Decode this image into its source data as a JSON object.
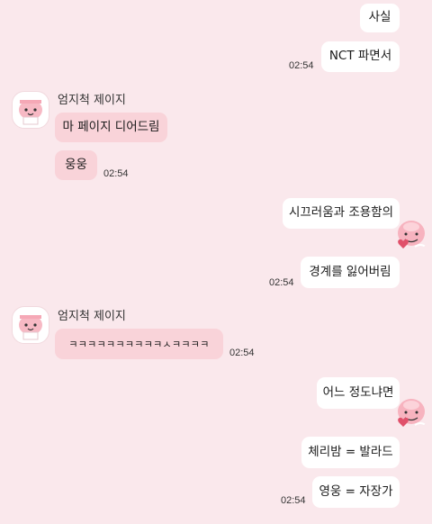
{
  "messages": {
    "m1": "사실",
    "m2": "NCT 파면서",
    "t1": "02:54",
    "sender1": "엄지척 제이지",
    "m3": "마 페이지 디어드림",
    "m4": "웅웅",
    "t2": "02:54",
    "m5": "시끄러움과 조용함의",
    "m6": "경계를 잃어버림",
    "t3": "02:54",
    "sender2": "엄지척 제이지",
    "m7": "ㅋㅋㅋㅋㅋㅋㅋㅋㅋㅋㅅㅋㅋㅋㅋ",
    "t4": "02:54",
    "m8": "어느 정도냐면",
    "m9": "체리밤 = 발라드",
    "m10": "영웅 = 자장가",
    "t5": "02:54"
  },
  "icons": {
    "friend_avatar": "peach-character-avatar",
    "my_avatar": "peach-character-heart-avatar"
  },
  "colors": {
    "background": "#fae8ec",
    "outgoing_bubble": "#ffffff",
    "incoming_bubble": "#f9d3d9"
  }
}
